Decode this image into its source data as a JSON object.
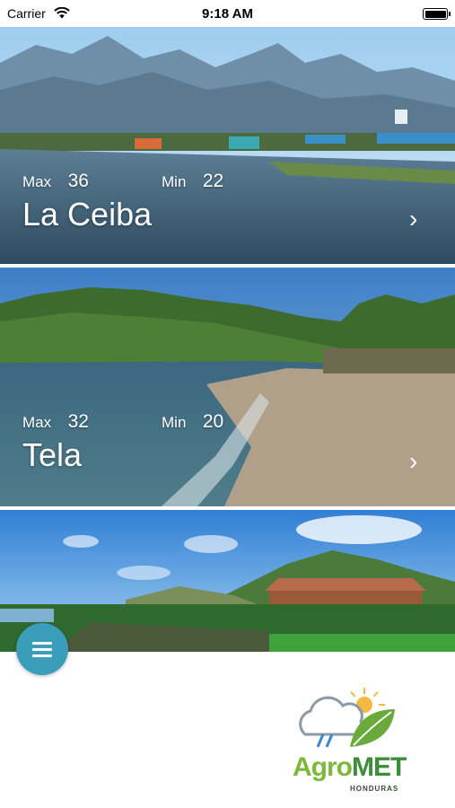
{
  "status_bar": {
    "carrier": "Carrier",
    "time": "9:18 AM"
  },
  "cities": [
    {
      "name": "La Ceiba",
      "max_label": "Max",
      "max": "36",
      "min_label": "Min",
      "min": "22"
    },
    {
      "name": "Tela",
      "max_label": "Max",
      "max": "32",
      "min_label": "Min",
      "min": "20"
    }
  ],
  "logo": {
    "agro": "Agro",
    "met": "MET",
    "country": "HONDURAS"
  },
  "icons": {
    "menu": "hamburger-menu-icon",
    "chevron": "chevron-right-icon",
    "wifi": "wifi-icon",
    "battery": "battery-icon"
  },
  "colors": {
    "menu_button": "#3a9dba",
    "logo_green_light": "#7cb93a",
    "logo_green_dark": "#3d8d3b"
  }
}
